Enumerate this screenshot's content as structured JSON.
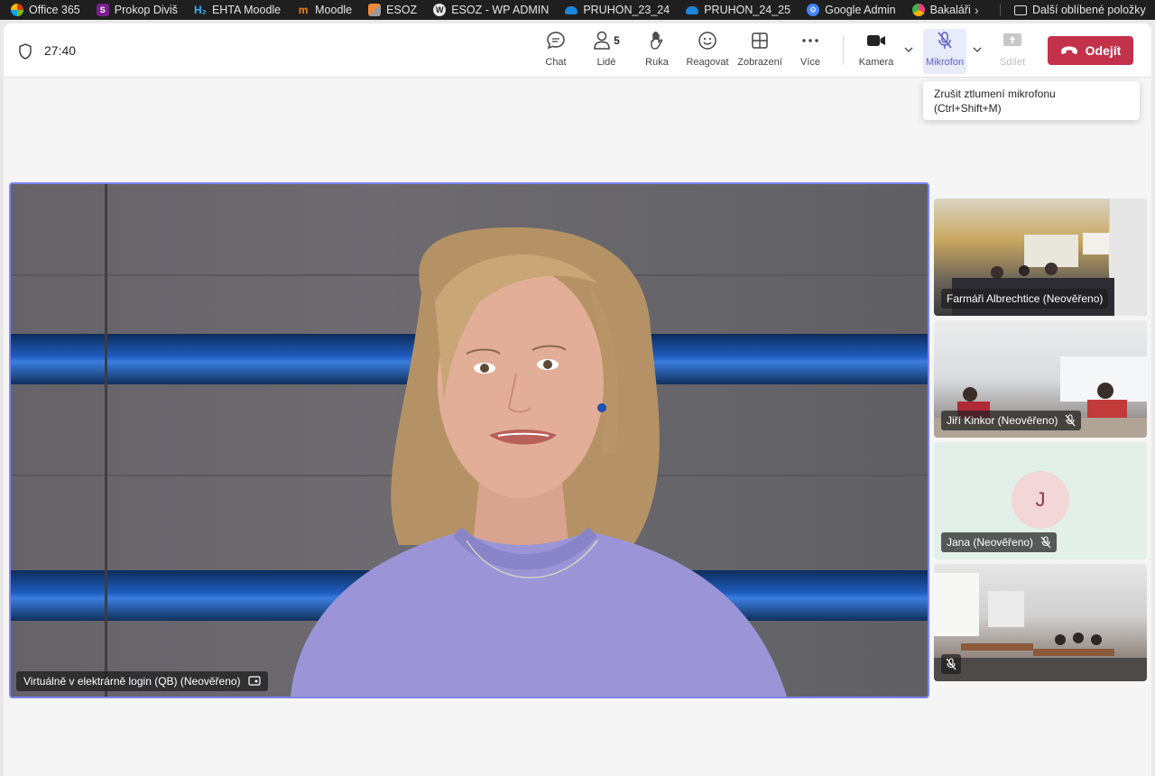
{
  "bookmarks": {
    "items": [
      {
        "label": "Office 365",
        "color": "#d83b01",
        "icon": "office-icon"
      },
      {
        "label": "Prokop Diviš",
        "color": "#7a1f8f",
        "icon": "prokop-icon"
      },
      {
        "label": "EHTA Moodle",
        "color": "#1e90d6",
        "icon": "h2-icon"
      },
      {
        "label": "Moodle",
        "color": "#f98012",
        "icon": "moodle-icon"
      },
      {
        "label": "ESOZ",
        "color": "#e06c2b",
        "icon": "esoz-icon"
      },
      {
        "label": "ESOZ - WP ADMIN",
        "color": "#3a3a3a",
        "icon": "wordpress-icon"
      },
      {
        "label": "PRUHON_23_24",
        "color": "#1b86d9",
        "icon": "onedrive-icon"
      },
      {
        "label": "PRUHON_24_25",
        "color": "#1b86d9",
        "icon": "onedrive-icon"
      },
      {
        "label": "Google Admin",
        "color": "#4285f4",
        "icon": "google-admin-icon"
      },
      {
        "label": "Bakaláři",
        "color": "#e8437c",
        "icon": "bakalari-icon"
      }
    ],
    "other_label": "Další oblíbené položky"
  },
  "toolbar": {
    "timer": "27:40",
    "chat_label": "Chat",
    "people_label": "Lidé",
    "people_count": "5",
    "hand_label": "Ruka",
    "react_label": "Reagovat",
    "view_label": "Zobrazení",
    "more_label": "Více",
    "camera_label": "Kamera",
    "mic_label": "Mikrofon",
    "share_label": "Sdílet",
    "leave_label": "Odejít"
  },
  "tooltip": {
    "line1": "Zrušit ztlumení mikrofonu",
    "line2": "(Ctrl+Shift+M)"
  },
  "main_video": {
    "name": "Virtuálně v elektrárně login (QB) (Neověřeno)"
  },
  "participants": [
    {
      "name": "Farmáři Albrechtice (Neověřeno)",
      "muted": false
    },
    {
      "name": "Jiří Kinkor (Neověřeno)",
      "muted": true
    },
    {
      "name": "Jana (Neověřeno)",
      "muted": true,
      "initial": "J"
    },
    {
      "name": "",
      "muted": true
    }
  ],
  "colors": {
    "accent": "#5b5fc7",
    "leave": "#c4314b",
    "highlight_border": "#7f85f5"
  }
}
